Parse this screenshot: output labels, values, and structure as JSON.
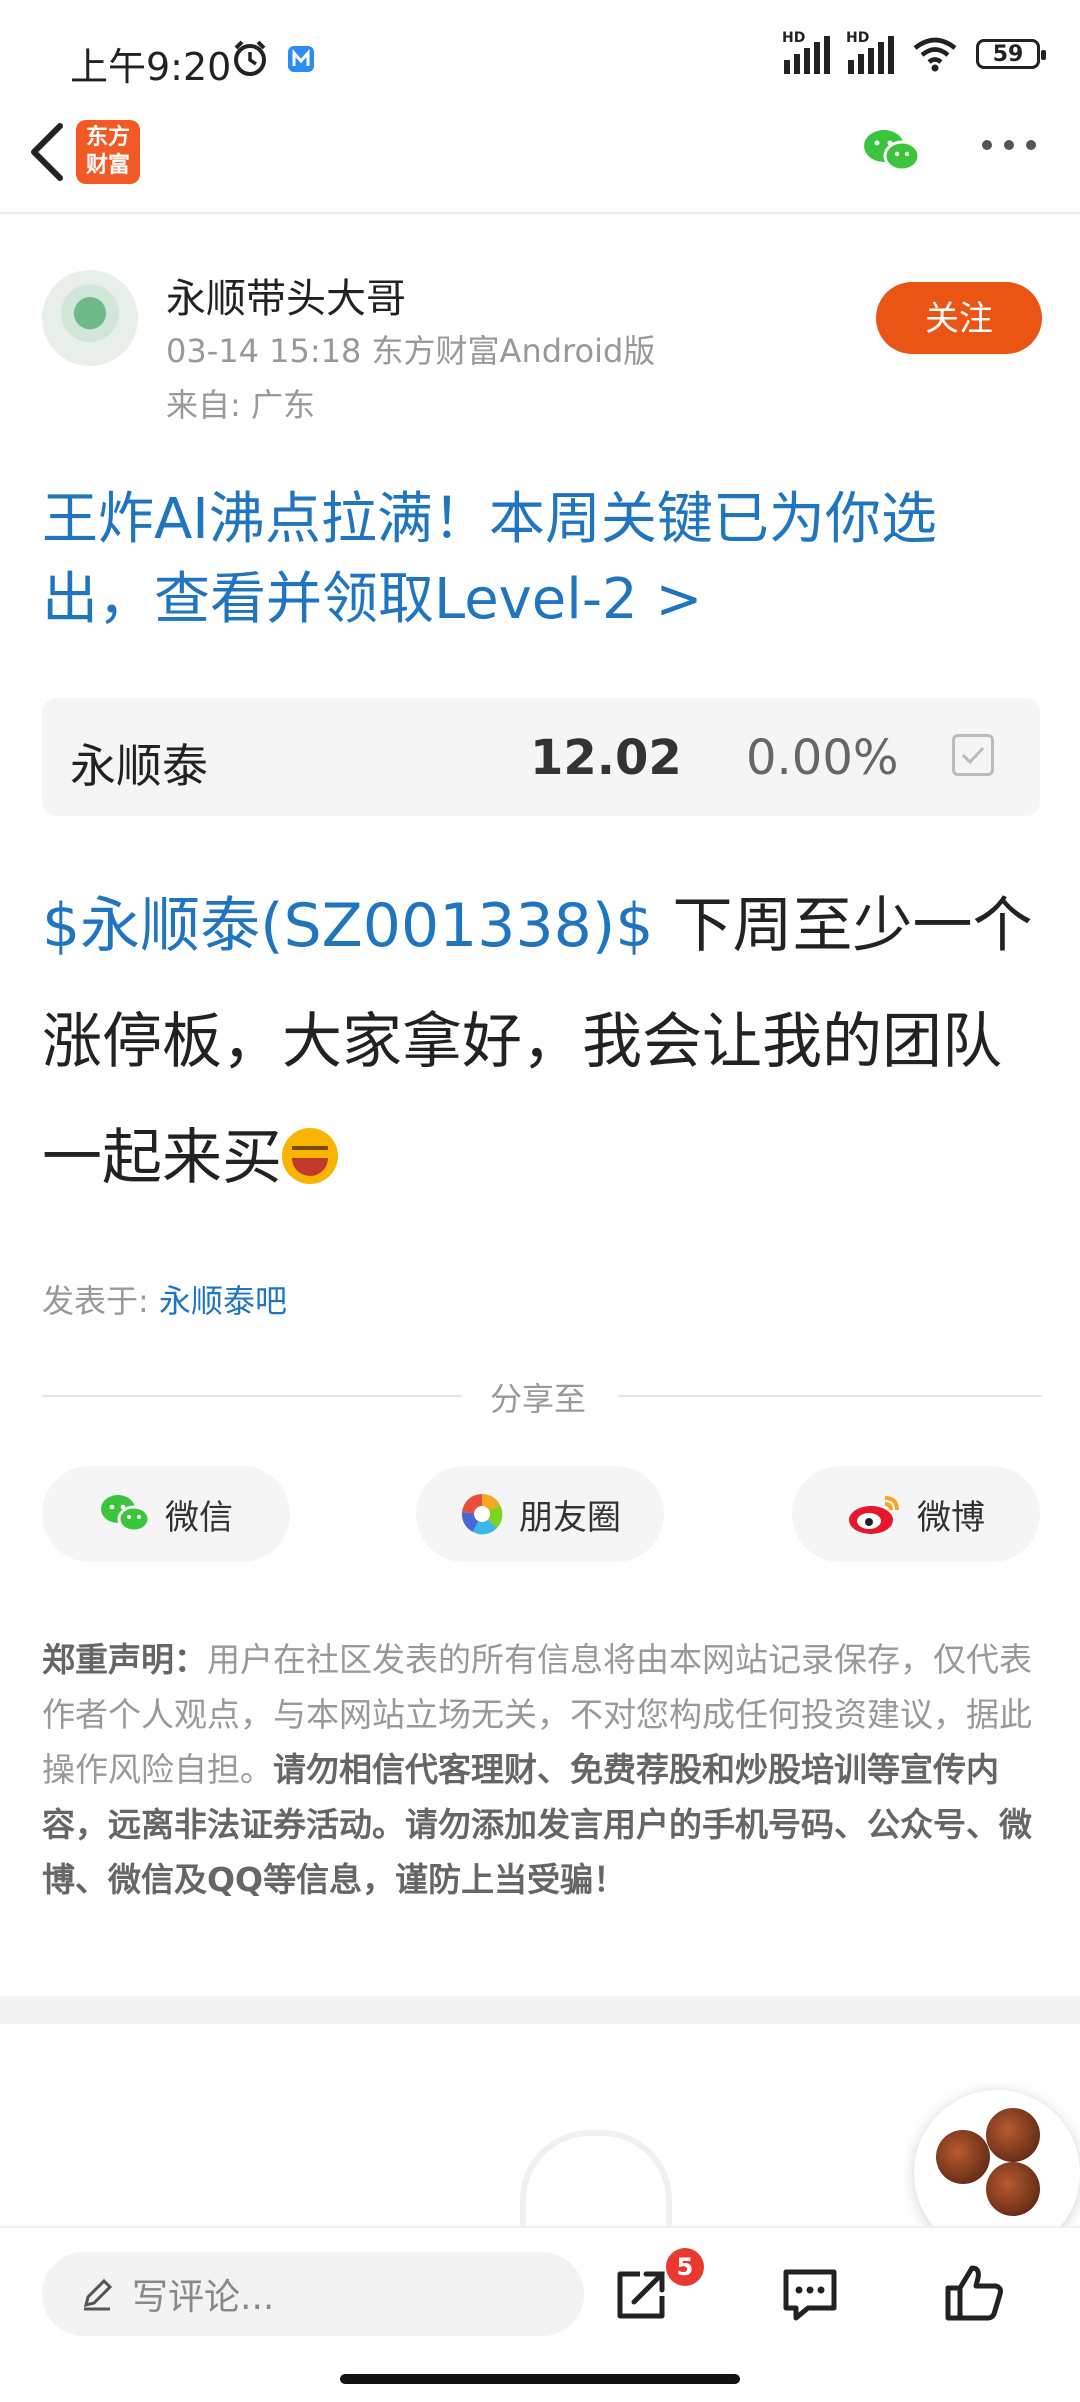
{
  "status_bar": {
    "time": "上午9:20",
    "battery": "59"
  },
  "nav": {
    "logo_text_line1": "东方",
    "logo_text_line2": "财富"
  },
  "author": {
    "name": "永顺带头大哥",
    "meta": "03-14 15:18 东方财富Android版",
    "location": "来自: 广东",
    "follow_label": "关注"
  },
  "promo_text": "王炸AI沸点拉满！本周关键已为你选出，查看并领取Level-2 >",
  "stock": {
    "name": "永顺泰",
    "price": "12.02",
    "change": "0.00%"
  },
  "post": {
    "tag": "$永顺泰(SZ001338)$",
    "text": "下周至少一个涨停板，大家拿好，我会让我的团队一起来买"
  },
  "posted_in": {
    "label": "发表于: ",
    "bar": "永顺泰吧"
  },
  "share": {
    "title": "分享至",
    "buttons": [
      {
        "label": "微信",
        "icon": "wechat-icon"
      },
      {
        "label": "朋友圈",
        "icon": "moments-icon"
      },
      {
        "label": "微博",
        "icon": "weibo-icon"
      }
    ]
  },
  "disclaimer": {
    "title": "郑重声明：",
    "normal": "用户在社区发表的所有信息将由本网站记录保存，仅代表作者个人观点，与本网站立场无关，不对您构成任何投资建议，据此操作风险自担。",
    "strong": "请勿相信代客理财、免费荐股和炒股培训等宣传内容，远离非法证券活动。请勿添加发言用户的手机号码、公众号、微博、微信及QQ等信息，谨防上当受骗！"
  },
  "bottom_bar": {
    "comment_placeholder": "写评论...",
    "share_badge": "5"
  },
  "colors": {
    "accent_orange": "#ea5414",
    "link_blue": "#1f75c0",
    "badge_red": "#e8382f"
  }
}
